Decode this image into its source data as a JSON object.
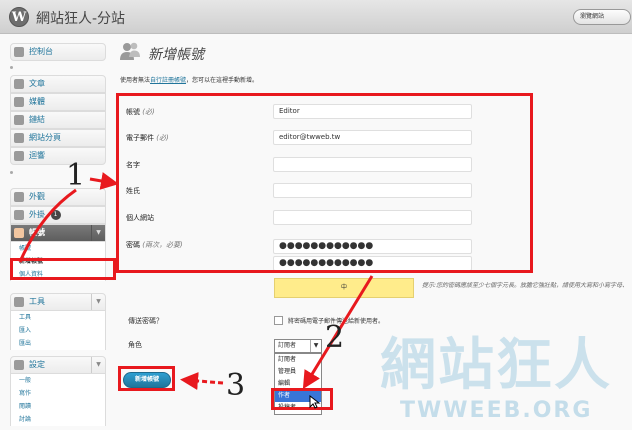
{
  "header": {
    "logo_text": "W",
    "site_title": "網站狂人-分站",
    "view_site_label": "瀏覽網站"
  },
  "sidebar": {
    "dashboard": "控制台",
    "posts": "文章",
    "media": "媒體",
    "links": "鏈結",
    "pages": "網站分頁",
    "comments": "迴響",
    "appearance": "外觀",
    "plugins": "外掛",
    "plugins_badge": "1",
    "users": "帳號",
    "users_sub": [
      "帳號",
      "新增帳號",
      "個人資料"
    ],
    "tools": "工具",
    "tools_sub": [
      "工具",
      "匯入",
      "匯出"
    ],
    "settings": "設定",
    "settings_sub": [
      "一般",
      "寫作",
      "閱讀",
      "討論"
    ]
  },
  "main": {
    "page_title": "新增帳號",
    "intro_prefix": "使用者無法",
    "intro_link": "自行註冊帳號",
    "intro_suffix": "，您可以在這裡手動新增。",
    "fields": {
      "username_label": "帳號",
      "username_req": "(必)",
      "username_value": "Editor",
      "email_label": "電子郵件",
      "email_req": "(必)",
      "email_value": "editor@twweb.tw",
      "firstname_label": "名字",
      "lastname_label": "姓氏",
      "website_label": "個人網站",
      "password_label": "密碼",
      "password_req": "(兩次，必要)",
      "password1_value": "●●●●●●●●●●●●",
      "password2_value": "●●●●●●●●●●●●"
    },
    "strength_label": "中",
    "password_hint": "提示:您的密碼應該至少七個字元長。放膽它強壯點，請使用大寫和小寫字母、",
    "send_password_label": "傳送密碼？",
    "send_password_text": "將密碼用電子郵件傳送給新使用者。",
    "role_label": "角色",
    "role_selected": "訂閱者",
    "role_options": [
      "訂閱者",
      "管理員",
      "編輯",
      "作者",
      "投稿者"
    ],
    "submit_label": "新增帳號"
  },
  "annotations": {
    "step1": "1",
    "step2": "2",
    "step3": "3",
    "watermark_cn": "網站狂人",
    "watermark_en": "TWWEEB.ORG"
  },
  "colors": {
    "annotation_red": "#e8191e",
    "link_blue": "#21759b",
    "strength_yellow": "#ffec8b"
  }
}
